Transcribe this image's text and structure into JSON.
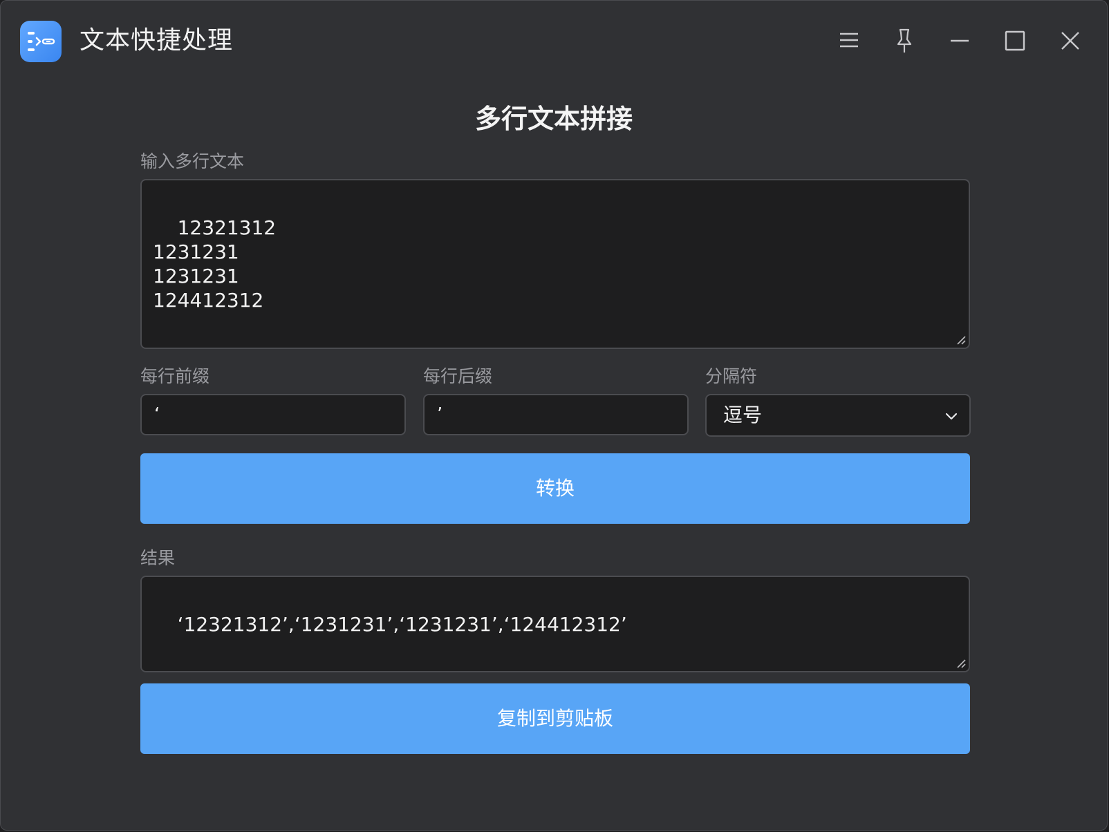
{
  "window": {
    "title": "文本快捷处理",
    "icons": {
      "app": "text-merge-app-icon",
      "menu": "hamburger-menu-icon",
      "pin": "pin-icon",
      "minimize": "minimize-icon",
      "maximize": "maximize-icon",
      "close": "close-icon"
    }
  },
  "main": {
    "heading": "多行文本拼接",
    "input_label": "输入多行文本",
    "input_text": "12321312\n1231231\n1231231\n124412312",
    "prefix_label": "每行前缀",
    "prefix_value": "‘",
    "suffix_label": "每行后缀",
    "suffix_value": "’",
    "separator_label": "分隔符",
    "separator_value": "逗号",
    "convert_button": "转换",
    "result_label": "结果",
    "result_text": "‘12321312’,‘1231231’,‘1231231’,‘124412312’",
    "copy_button": "复制到剪贴板"
  },
  "colors": {
    "window_bg": "#303134",
    "field_bg": "#1e1e1f",
    "accent_button": "#58a5f6",
    "label_text": "#9a9ba0"
  }
}
